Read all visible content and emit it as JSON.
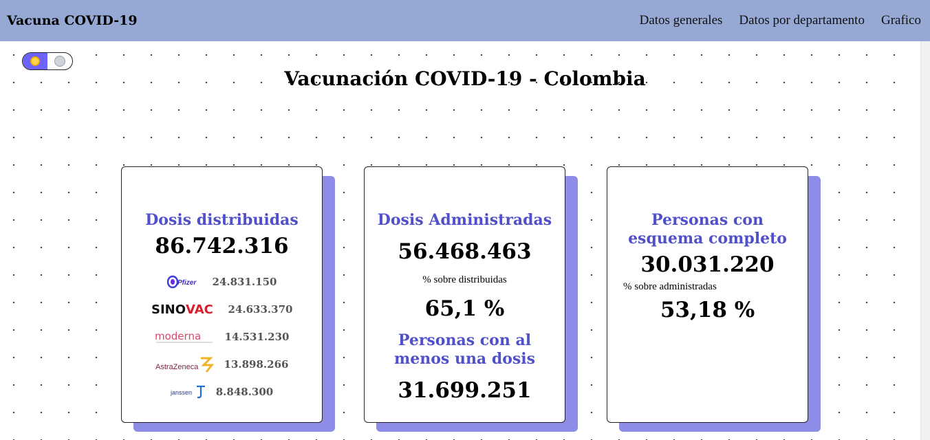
{
  "navbar": {
    "brand": "Vacuna COVID-19",
    "links": [
      "Datos generales",
      "Datos por departamento",
      "Grafico"
    ]
  },
  "theme_toggle": {
    "state": "light"
  },
  "page": {
    "title": "Vacunación COVID-19 - Colombia"
  },
  "cards": {
    "distribuidas": {
      "label": "Dosis distribuidas",
      "value": "86.742.316",
      "brands": [
        {
          "name": "Pfizer",
          "value": "24.831.150"
        },
        {
          "name": "SINOVAC",
          "value": "24.633.370"
        },
        {
          "name": "moderna",
          "value": "14.531.230"
        },
        {
          "name": "AstraZeneca",
          "value": "13.898.266"
        },
        {
          "name": "janssen",
          "value": "8.848.300"
        }
      ]
    },
    "administradas": {
      "label": "Dosis Administradas",
      "value": "56.468.463",
      "pct_label": "% sobre distribuidas",
      "pct_value": "65,1 %",
      "label2": "Personas con al menos una dosis",
      "value2": "31.699.251"
    },
    "esquema": {
      "label": "Personas con esquema completo",
      "value": "30.031.220",
      "pct_label": "% sobre administradas",
      "pct_value": "53,18 %"
    }
  },
  "colors": {
    "navbar": "#95a9d4",
    "accent": "#5050c8",
    "card_shadow": "#8d8de8",
    "toggle_on": "#6c63ff"
  }
}
